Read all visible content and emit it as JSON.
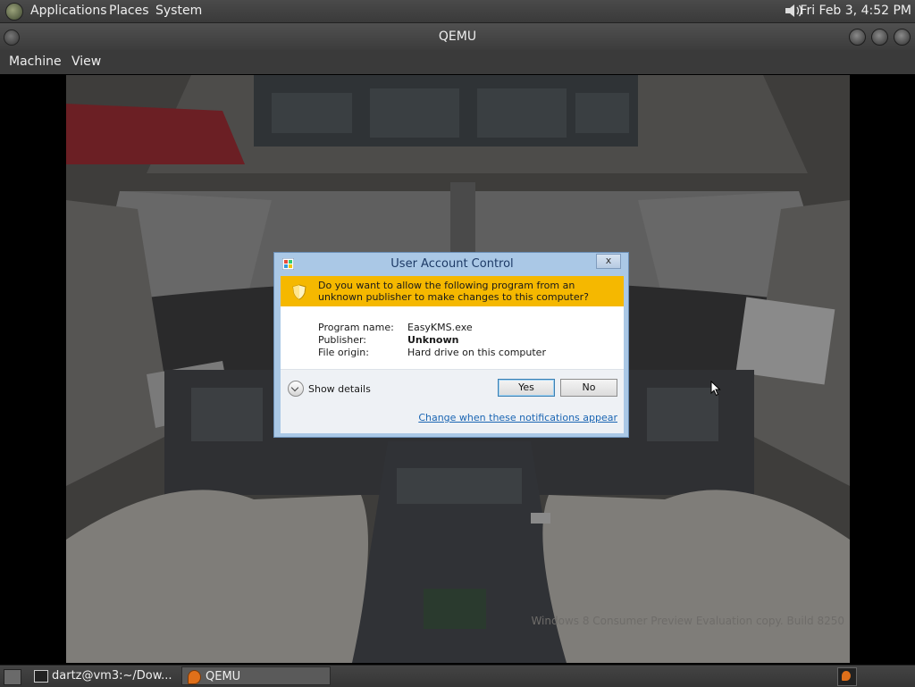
{
  "top_panel": {
    "menus": [
      "Applications",
      "Places",
      "System"
    ],
    "clock": "Fri Feb  3,  4:52 PM",
    "icons": [
      "gnome-foot-icon",
      "speaker-icon"
    ]
  },
  "window": {
    "title": "QEMU",
    "menubar": [
      "Machine",
      "View"
    ]
  },
  "uac": {
    "title": "User Account Control",
    "close_label": "x",
    "question": "Do you want to allow the following program from an unknown publisher to make changes to this computer?",
    "program_name_label": "Program name:",
    "program_name": "EasyKMS.exe",
    "publisher_label": "Publisher:",
    "publisher": "Unknown",
    "file_origin_label": "File origin:",
    "file_origin": "Hard drive on this computer",
    "show_details": "Show details",
    "yes": "Yes",
    "no": "No",
    "change_link": "Change when these notifications appear",
    "colors": {
      "banner": "#f5b800",
      "frame": "#aac8e6",
      "link": "#1a65b3"
    }
  },
  "desktop": {
    "watermark_line1": "Windows 8 Consumer Preview Evaluation copy. Build 8250"
  },
  "taskbar": {
    "tasks": [
      {
        "label": "dartz@vm3:~/Dow...",
        "icon": "terminal-icon"
      },
      {
        "label": "QEMU",
        "icon": "qemu-icon",
        "active": true
      }
    ]
  }
}
